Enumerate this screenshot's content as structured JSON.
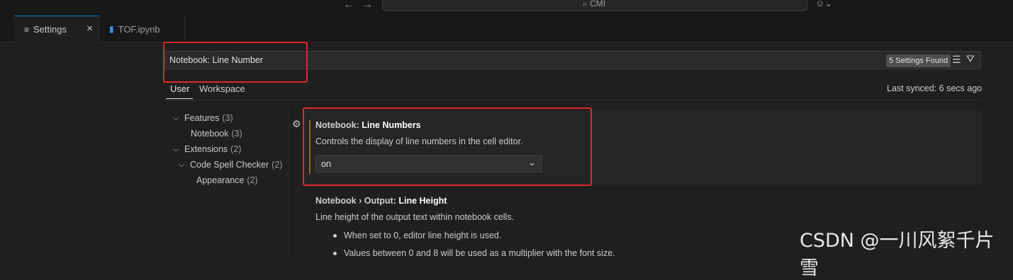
{
  "titlebar": {
    "back_icon": "arrow-left",
    "forward_icon": "arrow-right",
    "command_center_text": "CMI",
    "copilot_icon": "copilot"
  },
  "tabs": [
    {
      "label": "Settings",
      "icon": "settings-lines",
      "active": true,
      "close": "×"
    },
    {
      "label": "TOF.ipynb",
      "icon": "notebook-file",
      "active": false
    }
  ],
  "search": {
    "value": "Notebook: Line Number",
    "found_badge": "5 Settings Found"
  },
  "scope": {
    "user_label": "User",
    "workspace_label": "Workspace",
    "last_synced": "Last synced: 6 secs ago"
  },
  "toc": [
    {
      "label": "Features",
      "count": "(3)"
    },
    {
      "label": "Notebook",
      "count": "(3)"
    },
    {
      "label": "Extensions",
      "count": "(2)"
    },
    {
      "label": "Code Spell Checker",
      "count": "(2)"
    },
    {
      "label": "Appearance",
      "count": "(2)"
    }
  ],
  "settings": [
    {
      "prefix": "Notebook: ",
      "title": "Line Numbers",
      "description": "Controls the display of line numbers in the cell editor.",
      "value": "on"
    },
    {
      "prefix": "Notebook › Output: ",
      "title": "Line Height",
      "description": "Line height of the output text within notebook cells.",
      "bullets": [
        "When set to 0, editor line height is used.",
        "Values between 0 and 8 will be used as a multiplier with the font size."
      ]
    }
  ],
  "watermark": "CSDN @一川风絮千片雪",
  "colors": {
    "accent": "#0078d4",
    "highlight_box": "#e02828",
    "modified_indicator": "#8a6d20"
  }
}
